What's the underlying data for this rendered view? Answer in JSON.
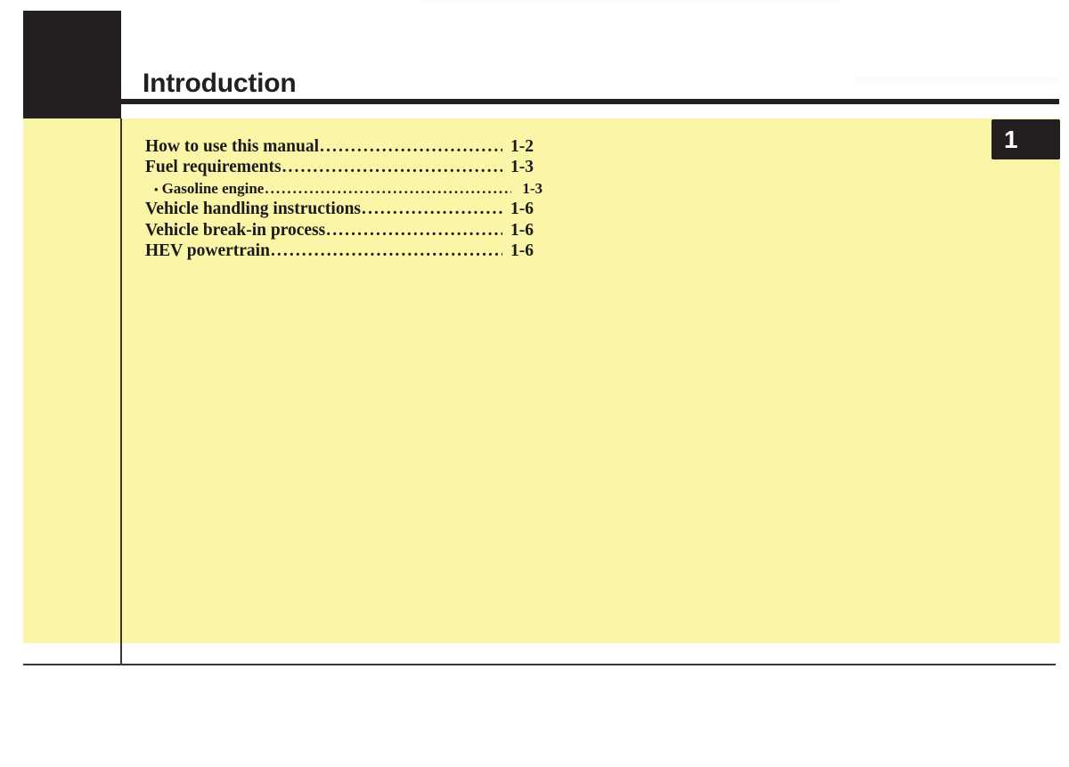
{
  "page": {
    "title": "Introduction",
    "chapter_tab_number": "1",
    "background_color": "#ffffff",
    "panel_color": "#fbf5a8",
    "ink_color": "#231f20"
  },
  "toc": {
    "entries": [
      {
        "label": "How to use this manual",
        "page": "1-2",
        "level": 1,
        "bullet": ""
      },
      {
        "label": "Fuel requirements",
        "page": "1-3",
        "level": 1,
        "bullet": ""
      },
      {
        "label": "Gasoline engine",
        "page": "1-3",
        "level": 2,
        "bullet": "•"
      },
      {
        "label": "Vehicle handling instructions",
        "page": "1-6",
        "level": 1,
        "bullet": ""
      },
      {
        "label": "Vehicle break-in process",
        "page": "1-6",
        "level": 1,
        "bullet": ""
      },
      {
        "label": "HEV powertrain",
        "page": "1-6",
        "level": 1,
        "bullet": ""
      }
    ],
    "leader_char": "."
  }
}
